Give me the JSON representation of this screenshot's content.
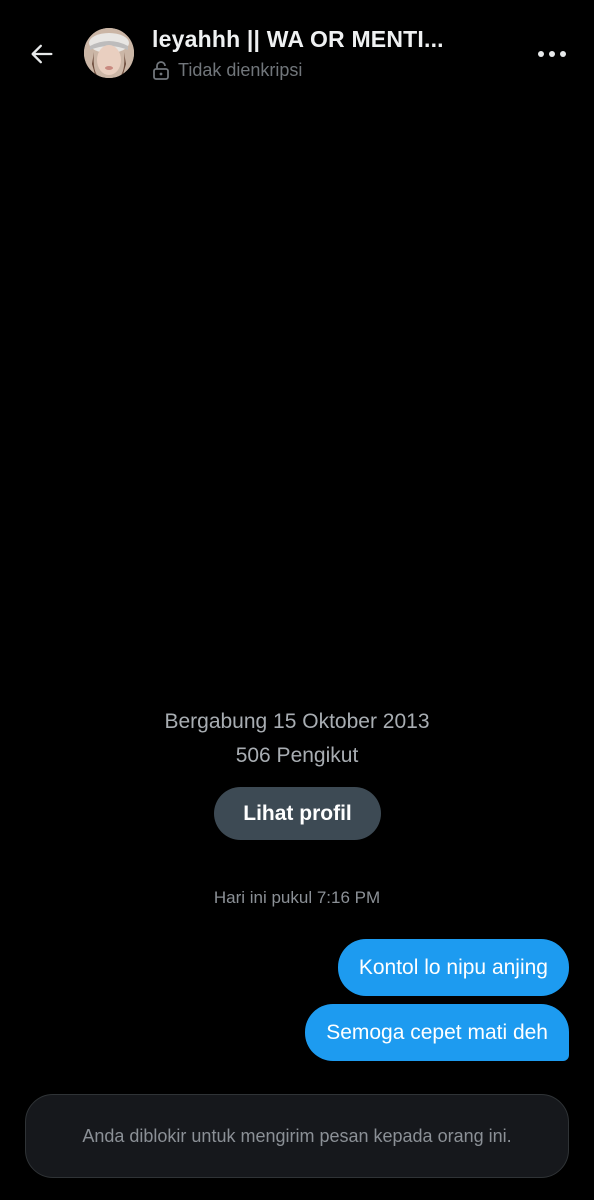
{
  "header": {
    "back_icon": "arrow-left-icon",
    "title": "leyahhh || WA OR MENTI...",
    "encryption_status": "Tidak dienkripsi",
    "lock_icon": "unlocked-padlock-icon",
    "more_icon": "more-dots-icon"
  },
  "profile": {
    "joined": "Bergabung 15 Oktober 2013",
    "followers": "506 Pengikut",
    "view_profile_label": "Lihat profil"
  },
  "conversation": {
    "timestamp": "Hari ini pukul 7:16 PM",
    "messages": [
      {
        "text": "Kontol lo nipu anjing",
        "sender": "me"
      },
      {
        "text": "Semoga cepet mati deh",
        "sender": "me"
      }
    ]
  },
  "composer": {
    "blocked_notice": "Anda diblokir untuk mengirim pesan kepada orang ini."
  },
  "colors": {
    "background": "#000000",
    "bubble": "#1d9bf0",
    "button": "#3d4a54",
    "muted_text": "#71767b"
  }
}
